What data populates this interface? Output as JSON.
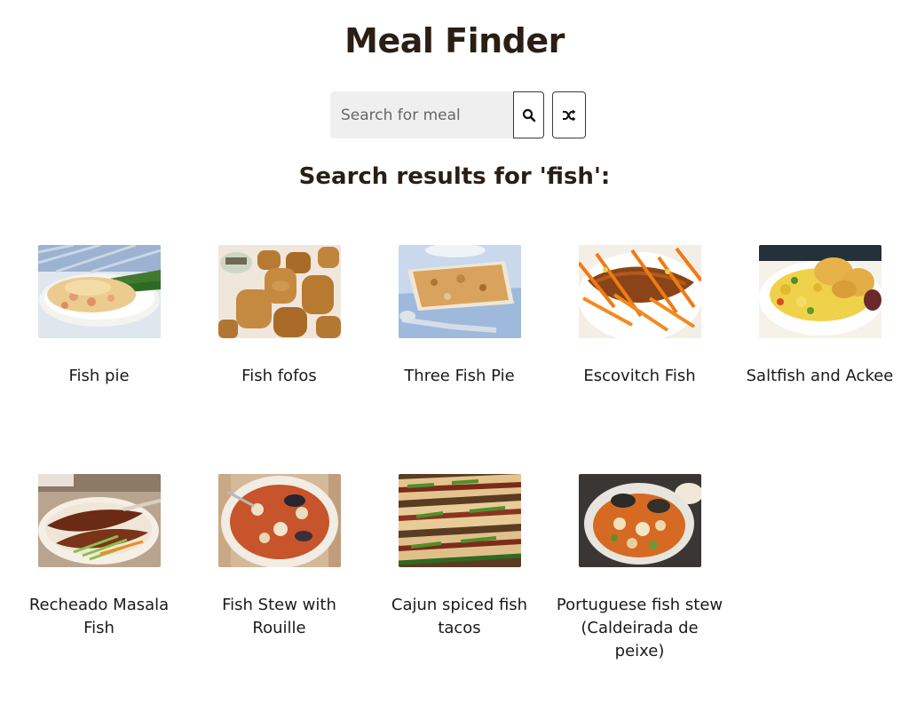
{
  "app": {
    "title": "Meal Finder"
  },
  "search": {
    "placeholder": "Search for meal",
    "value": "",
    "button_icon": "search-icon",
    "random_icon": "shuffle-icon"
  },
  "results": {
    "heading": "Search results for 'fish':",
    "meals": [
      {
        "name": "Fish pie"
      },
      {
        "name": "Fish fofos"
      },
      {
        "name": "Three Fish Pie"
      },
      {
        "name": "Escovitch Fish"
      },
      {
        "name": "Saltfish and Ackee"
      },
      {
        "name": "Recheado Masala Fish"
      },
      {
        "name": "Fish Stew with Rouille"
      },
      {
        "name": "Cajun spiced fish tacos"
      },
      {
        "name": "Portuguese fish stew (Caldeirada de peixe)"
      }
    ]
  }
}
